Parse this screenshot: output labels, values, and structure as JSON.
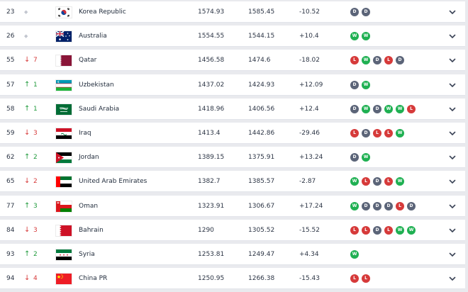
{
  "colors": {
    "win": "#1fb052",
    "draw": "#5b6478",
    "loss": "#d63a3a",
    "up": "#1f9a3b",
    "down": "#d63a3a"
  },
  "rows": [
    {
      "rank": "23",
      "move": "none",
      "move_num": "",
      "flag": "korea",
      "country": "Korea Republic",
      "points": "1574.93",
      "prev_points": "1585.45",
      "diff": "-10.52",
      "form": [
        "D",
        "D"
      ]
    },
    {
      "rank": "26",
      "move": "none",
      "move_num": "",
      "flag": "australia",
      "country": "Australia",
      "points": "1554.55",
      "prev_points": "1544.15",
      "diff": "+10.4",
      "form": [
        "W",
        "W"
      ]
    },
    {
      "rank": "55",
      "move": "down",
      "move_num": "7",
      "flag": "qatar",
      "country": "Qatar",
      "points": "1456.58",
      "prev_points": "1474.6",
      "diff": "-18.02",
      "form": [
        "L",
        "W",
        "D",
        "L",
        "D"
      ]
    },
    {
      "rank": "57",
      "move": "up",
      "move_num": "1",
      "flag": "uzbekistan",
      "country": "Uzbekistan",
      "points": "1437.02",
      "prev_points": "1424.93",
      "diff": "+12.09",
      "form": [
        "D",
        "W"
      ]
    },
    {
      "rank": "58",
      "move": "up",
      "move_num": "1",
      "flag": "saudi",
      "country": "Saudi Arabia",
      "points": "1418.96",
      "prev_points": "1406.56",
      "diff": "+12.4",
      "form": [
        "D",
        "W",
        "D",
        "W",
        "W",
        "L"
      ]
    },
    {
      "rank": "59",
      "move": "down",
      "move_num": "3",
      "flag": "iraq",
      "country": "Iraq",
      "points": "1413.4",
      "prev_points": "1442.86",
      "diff": "-29.46",
      "form": [
        "L",
        "D",
        "L",
        "L",
        "W"
      ]
    },
    {
      "rank": "62",
      "move": "up",
      "move_num": "2",
      "flag": "jordan",
      "country": "Jordan",
      "points": "1389.15",
      "prev_points": "1375.91",
      "diff": "+13.24",
      "form": [
        "D",
        "W"
      ]
    },
    {
      "rank": "65",
      "move": "down",
      "move_num": "2",
      "flag": "uae",
      "country": "United Arab Emirates",
      "points": "1382.7",
      "prev_points": "1385.57",
      "diff": "-2.87",
      "form": [
        "W",
        "L",
        "D",
        "L",
        "W"
      ]
    },
    {
      "rank": "77",
      "move": "up",
      "move_num": "3",
      "flag": "oman",
      "country": "Oman",
      "points": "1323.91",
      "prev_points": "1306.67",
      "diff": "+17.24",
      "form": [
        "W",
        "D",
        "D",
        "D",
        "L",
        "D"
      ]
    },
    {
      "rank": "84",
      "move": "down",
      "move_num": "3",
      "flag": "bahrain",
      "country": "Bahrain",
      "points": "1290",
      "prev_points": "1305.52",
      "diff": "-15.52",
      "form": [
        "L",
        "L",
        "D",
        "L",
        "W",
        "W"
      ]
    },
    {
      "rank": "93",
      "move": "up",
      "move_num": "2",
      "flag": "syria",
      "country": "Syria",
      "points": "1253.81",
      "prev_points": "1249.47",
      "diff": "+4.34",
      "form": [
        "W"
      ]
    },
    {
      "rank": "94",
      "move": "down",
      "move_num": "4",
      "flag": "china",
      "country": "China PR",
      "points": "1250.95",
      "prev_points": "1266.38",
      "diff": "-15.43",
      "form": [
        "L",
        "L"
      ]
    }
  ]
}
